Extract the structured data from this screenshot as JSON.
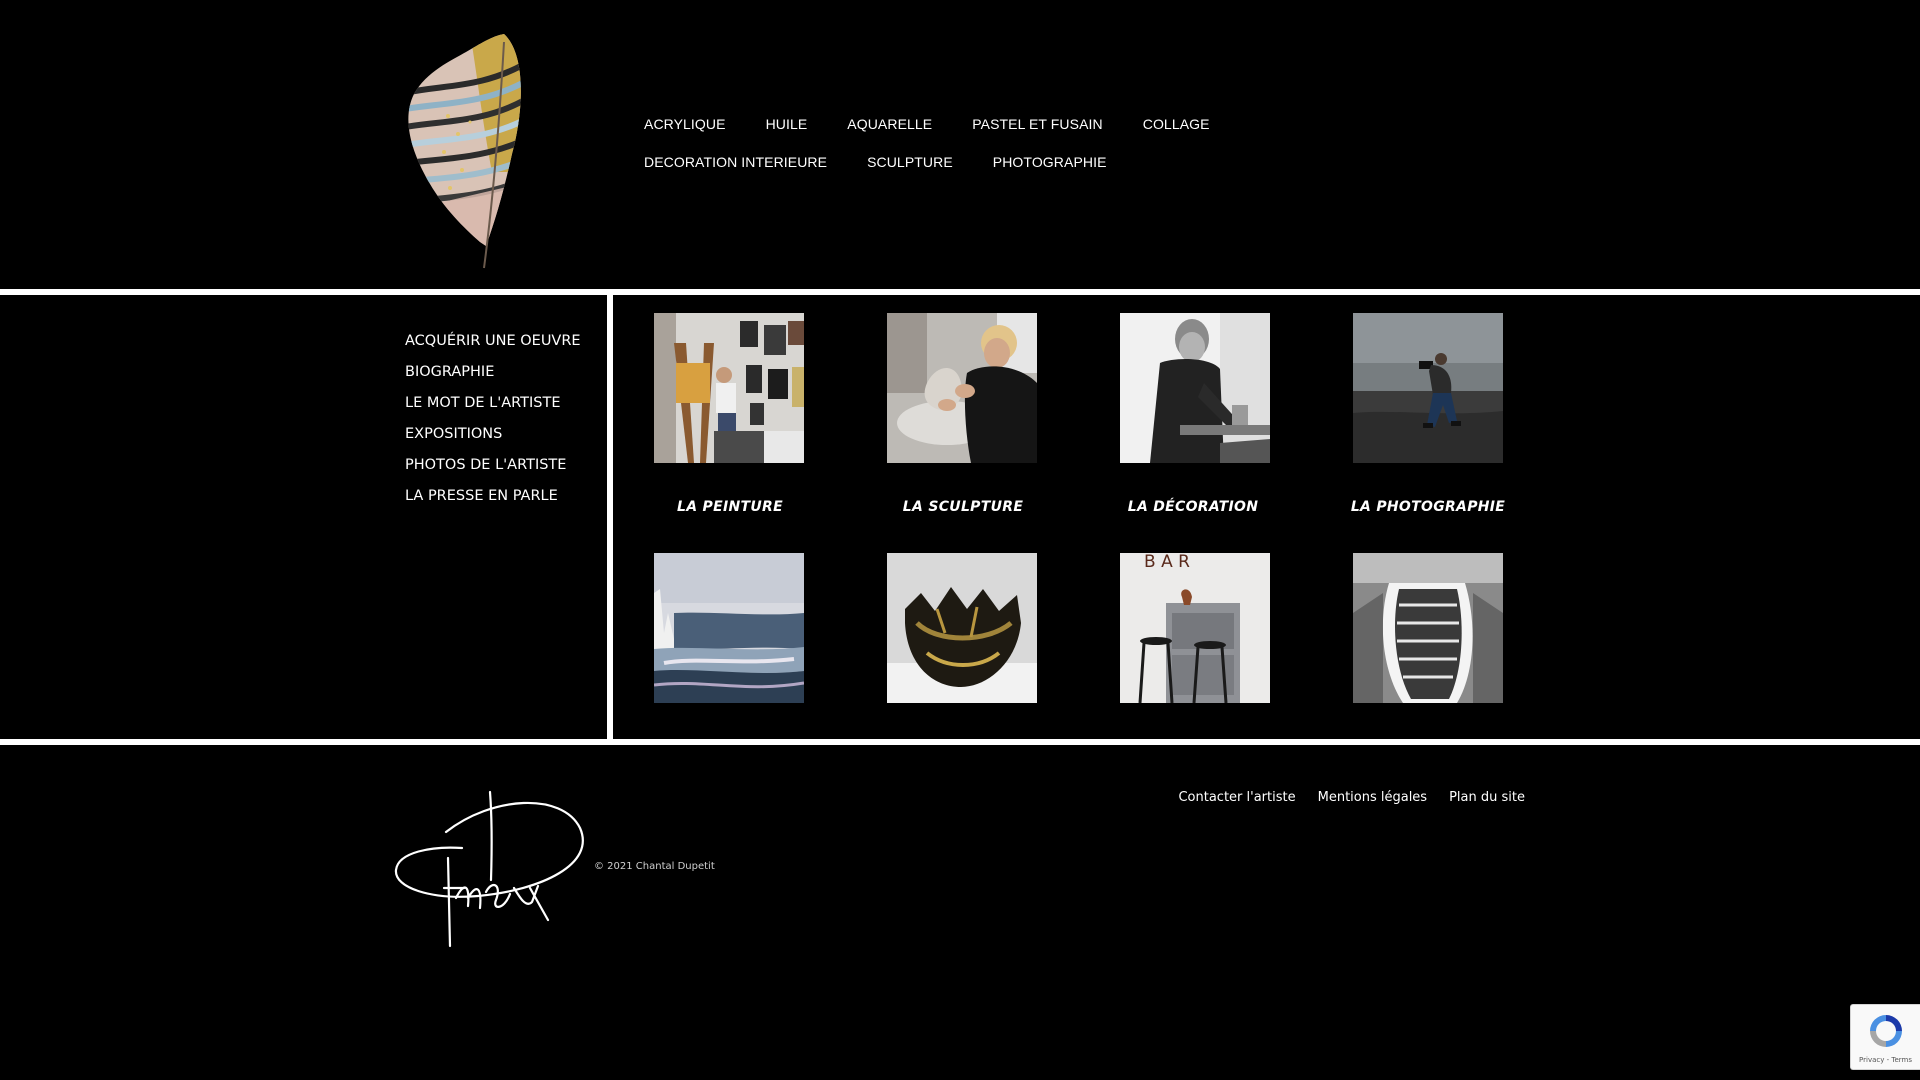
{
  "header": {
    "logo_alt": "Plume dorée",
    "nav_items": [
      {
        "label": "ACRYLIQUE"
      },
      {
        "label": "HUILE"
      },
      {
        "label": "AQUARELLE"
      },
      {
        "label": "PASTEL ET FUSAIN"
      },
      {
        "label": "COLLAGE"
      },
      {
        "label": "DECORATION INTERIEURE"
      },
      {
        "label": "SCULPTURE"
      },
      {
        "label": "PHOTOGRAPHIE"
      }
    ]
  },
  "sidebar": {
    "items": [
      {
        "label": "ACQUÉRIR UNE OEUVRE"
      },
      {
        "label": "BIOGRAPHIE"
      },
      {
        "label": "LE MOT DE L'ARTISTE"
      },
      {
        "label": "EXPOSITIONS"
      },
      {
        "label": "PHOTOS DE L'ARTISTE"
      },
      {
        "label": "LA PRESSE EN PARLE"
      }
    ]
  },
  "categories": [
    {
      "label": "LA PEINTURE"
    },
    {
      "label": "LA SCULPTURE"
    },
    {
      "label": "LA DÉCORATION"
    },
    {
      "label": "LA PHOTOGRAPHIE"
    }
  ],
  "artworks": {
    "bar_sign": "B A R"
  },
  "footer": {
    "copyright": "© 2021 Chantal Dupetit",
    "links": [
      {
        "label": "Contacter l'artiste"
      },
      {
        "label": "Mentions légales"
      },
      {
        "label": "Plan du site"
      }
    ]
  },
  "recaptcha": {
    "terms": "Privacy - Terms"
  },
  "colors": {
    "background": "#000000",
    "divider": "#ffffff",
    "text": "#ffffff",
    "feather_gold": "#c9a84a",
    "recaptcha_blue": "#4a90e2"
  }
}
